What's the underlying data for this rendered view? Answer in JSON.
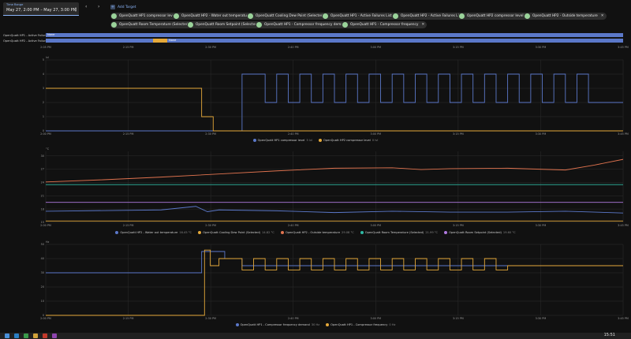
{
  "time_range": {
    "label": "Time Range",
    "value": "May 27, 2:00 PM – May 27, 3:00 PM"
  },
  "toolbar": {
    "prev": "‹",
    "next": "›",
    "add_target": "Add Target"
  },
  "targets": [
    "OpenQuatt HP1 compressor level",
    "OpenQuatt HP2 - Water out temperature",
    "OpenQuatt Cooling Dew Point (Selected)",
    "OpenQuatt HP1 - Active Failures List",
    "OpenQuatt HP2 - Active Failures List",
    "OpenQuatt HP2 compressor level",
    "OpenQuatt HP2 - Outside temperature",
    "OpenQuatt Room Temperature (Selected)",
    "OpenQuatt Room Setpoint (Selected)",
    "OpenQuatt HP1 - Compressor frequency demand",
    "OpenQuatt HP1 - Compressor frequency"
  ],
  "timeline": {
    "rows": [
      {
        "label": "OpenQuatt HP1 - Active Failures ...",
        "state": "None"
      },
      {
        "label": "OpenQuatt HP2 - Active Failures ...",
        "state": "None"
      }
    ],
    "ticks": [
      "2:05 PM",
      "2:15 PM",
      "2:30 PM",
      "2:40 PM",
      "3:00 PM",
      "3:15 PM",
      "3:30 PM",
      "3:45 PM"
    ]
  },
  "colors": {
    "blue": "#5b78c9",
    "yellow": "#e5a93a",
    "orange": "#e0734f",
    "teal": "#2fb9a4",
    "violet": "#b07ae0",
    "grid": "#2c2c2c"
  },
  "chart_data": [
    {
      "type": "line",
      "unit": "lvl",
      "ylim": [
        0,
        5
      ],
      "yticks": [
        0,
        1,
        2,
        3,
        4,
        5
      ],
      "x_ticks": [
        "2:00 PM",
        "2:15 PM",
        "2:30 PM",
        "2:40 PM",
        "3:00 PM",
        "3:15 PM",
        "3:30 PM",
        "3:45 PM"
      ],
      "series": [
        {
          "name": "OpenQuatt HP1 compressor level",
          "value": "5 lvl",
          "color": "#5b78c9",
          "x": [
            0,
            34,
            34,
            38,
            38,
            40,
            40,
            42,
            42,
            44,
            44,
            46,
            46,
            48,
            48,
            50,
            50,
            52,
            52,
            54,
            54,
            56,
            56,
            58,
            58,
            60,
            60,
            62,
            62,
            64,
            64,
            66,
            66,
            68,
            68,
            70,
            70,
            72,
            72,
            74,
            74,
            76,
            76,
            78,
            78,
            80,
            80,
            82,
            82,
            84,
            84,
            86,
            86,
            88,
            88,
            90,
            90,
            92,
            92,
            94,
            94,
            100
          ],
          "y": [
            0,
            0,
            4,
            4,
            2,
            2,
            4,
            4,
            2,
            2,
            4,
            4,
            2,
            2,
            4,
            4,
            2,
            2,
            4,
            4,
            2,
            2,
            4,
            4,
            2,
            2,
            4,
            4,
            2,
            2,
            4,
            4,
            2,
            2,
            4,
            4,
            2,
            2,
            4,
            4,
            2,
            2,
            4,
            4,
            2,
            2,
            4,
            4,
            2,
            2,
            4,
            4,
            2,
            2,
            4,
            4,
            2,
            2,
            4,
            4,
            2,
            2
          ]
        },
        {
          "name": "OpenQuatt HP2 compressor level",
          "value": "0 lvl",
          "color": "#e5a93a",
          "x": [
            0,
            27,
            27,
            29,
            29,
            100
          ],
          "y": [
            3,
            3,
            1,
            1,
            0,
            0
          ]
        }
      ]
    },
    {
      "type": "line",
      "unit": "°C",
      "ylim": [
        15,
        31
      ],
      "yticks": [
        15,
        18,
        21,
        24,
        27,
        30
      ],
      "x_ticks": [
        "2:00 PM",
        "2:15 PM",
        "2:30 PM",
        "2:40 PM",
        "3:00 PM",
        "3:15 PM",
        "3:30 PM",
        "3:45 PM"
      ],
      "series": [
        {
          "name": "OpenQuatt HP2 - Water out temperature",
          "value": "16.45 °C",
          "color": "#5b78c9",
          "x": [
            0,
            20,
            26,
            28,
            30,
            40,
            50,
            60,
            70,
            80,
            90,
            100
          ],
          "y": [
            17.5,
            17.8,
            18.6,
            17.4,
            17.8,
            17.6,
            17.2,
            17.5,
            17.3,
            17.3,
            17.5,
            17.1
          ]
        },
        {
          "name": "OpenQuatt Cooling Dew Point (Selected)",
          "value": "14.82 °C",
          "color": "#e5a93a",
          "x": [
            0,
            100
          ],
          "y": [
            15.3,
            15.3
          ]
        },
        {
          "name": "OpenQuatt HP2 - Outside temperature",
          "value": "29.08 °C",
          "color": "#e0734f",
          "x": [
            0,
            10,
            20,
            30,
            40,
            50,
            60,
            65,
            70,
            80,
            90,
            95,
            100
          ],
          "y": [
            24.1,
            24.6,
            25.2,
            25.9,
            26.6,
            27.2,
            27.3,
            26.9,
            27.1,
            27.2,
            26.8,
            27.9,
            29.2
          ]
        },
        {
          "name": "OpenQuatt Room Temperature (Selected)",
          "value": "21.99 °C",
          "color": "#2fb9a4",
          "x": [
            0,
            100
          ],
          "y": [
            23.5,
            23.5
          ]
        },
        {
          "name": "OpenQuatt Room Setpoint (Selected)",
          "value": "19.60 °C",
          "color": "#b07ae0",
          "x": [
            0,
            100
          ],
          "y": [
            19.5,
            19.5
          ]
        }
      ]
    },
    {
      "type": "line",
      "unit": "Hz",
      "ylim": [
        0,
        50
      ],
      "yticks": [
        0,
        10,
        20,
        30,
        40,
        50
      ],
      "x_ticks": [
        "2:00 PM",
        "2:15 PM",
        "2:30 PM",
        "2:40 PM",
        "3:00 PM",
        "3:15 PM",
        "3:30 PM",
        "3:45 PM"
      ],
      "series": [
        {
          "name": "OpenQuatt HP1 - Compressor frequency demand",
          "value": "30 Hz",
          "color": "#5b78c9",
          "x": [
            0,
            27,
            27,
            31,
            31,
            34,
            34,
            100
          ],
          "y": [
            30,
            30,
            45,
            45,
            40,
            40,
            35,
            35
          ]
        },
        {
          "name": "OpenQuatt HP1 - Compressor frequency",
          "value": "0 Hz",
          "color": "#e5a93a",
          "x": [
            0,
            27.5,
            27.5,
            28.5,
            28.5,
            30,
            30,
            34,
            34,
            36,
            36,
            38,
            38,
            40,
            40,
            42,
            42,
            44,
            44,
            46,
            46,
            48,
            48,
            50,
            50,
            52,
            52,
            54,
            54,
            56,
            56,
            58,
            58,
            60,
            60,
            62,
            62,
            64,
            64,
            66,
            66,
            68,
            68,
            70,
            70,
            72,
            72,
            74,
            74,
            76,
            76,
            78,
            78,
            80,
            80,
            100
          ],
          "y": [
            0,
            0,
            46,
            46,
            35,
            35,
            40,
            40,
            32,
            32,
            40,
            40,
            32,
            32,
            40,
            40,
            32,
            32,
            40,
            40,
            32,
            32,
            40,
            40,
            32,
            32,
            40,
            40,
            32,
            32,
            40,
            40,
            32,
            32,
            40,
            40,
            32,
            32,
            40,
            40,
            32,
            32,
            40,
            40,
            32,
            32,
            40,
            40,
            32,
            32,
            40,
            40,
            32,
            32,
            35,
            35
          ]
        }
      ]
    }
  ],
  "taskbar": {
    "clock": "15:51"
  }
}
